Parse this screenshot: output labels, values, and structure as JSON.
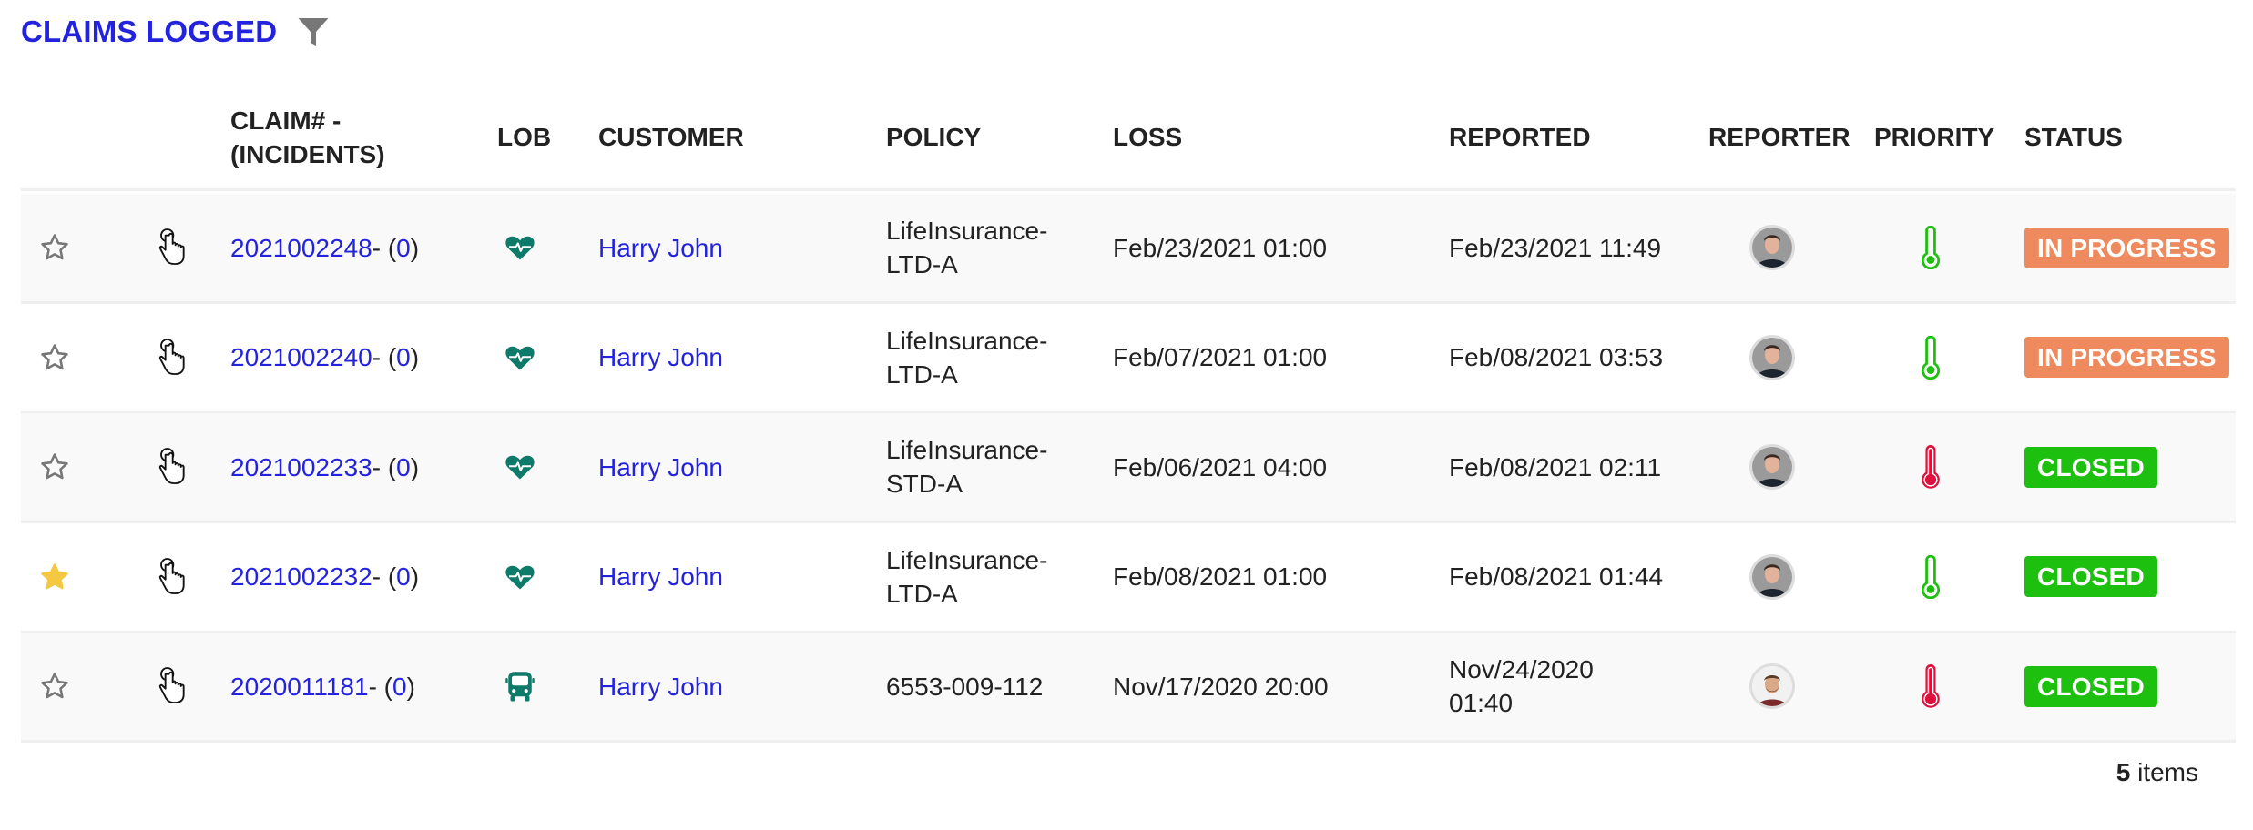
{
  "header": {
    "title": "CLAIMS LOGGED",
    "filter_icon": "filter-icon"
  },
  "colors": {
    "title": "#2323de",
    "link": "#2323de",
    "lob_icon": "#0d7a6a",
    "star_favorite": "#f5c842",
    "star_empty": "#777777",
    "priority_low": "#1ec010",
    "priority_high": "#e0103c",
    "status_in_progress": "#ee8a5e",
    "status_closed": "#1ec010"
  },
  "columns": {
    "claim": "CLAIM# -",
    "claim_line2": "(INCIDENTS)",
    "lob": "LOB",
    "customer": "CUSTOMER",
    "policy": "POLICY",
    "loss": "LOSS",
    "reported": "REPORTED",
    "reporter": "REPORTER",
    "priority": "PRIORITY",
    "status": "STATUS"
  },
  "rows": [
    {
      "favorite": false,
      "claim": "2021002248",
      "sep": " - (",
      "incidents": "0",
      "close": ")",
      "lob_icon": "heartbeat-icon",
      "customer": "Harry John",
      "policy": "LifeInsurance-",
      "policy_line2": "LTD-A",
      "loss": "Feb/23/2021 01:00",
      "reported": "Feb/23/2021 11:49",
      "reported_line2": "",
      "reporter_avatar": "avatar-1",
      "priority": "low",
      "status": "IN PROGRESS"
    },
    {
      "favorite": false,
      "claim": "2021002240",
      "sep": " - (",
      "incidents": "0",
      "close": ")",
      "lob_icon": "heartbeat-icon",
      "customer": "Harry John",
      "policy": "LifeInsurance-",
      "policy_line2": "LTD-A",
      "loss": "Feb/07/2021 01:00",
      "reported": "Feb/08/2021 03:53",
      "reported_line2": "",
      "reporter_avatar": "avatar-1",
      "priority": "low",
      "status": "IN PROGRESS"
    },
    {
      "favorite": false,
      "claim": "2021002233",
      "sep": " - (",
      "incidents": "0",
      "close": ")",
      "lob_icon": "heartbeat-icon",
      "customer": "Harry John",
      "policy": "LifeInsurance-",
      "policy_line2": "STD-A",
      "loss": "Feb/06/2021 04:00",
      "reported": "Feb/08/2021 02:11",
      "reported_line2": "",
      "reporter_avatar": "avatar-1",
      "priority": "high",
      "status": "CLOSED"
    },
    {
      "favorite": true,
      "claim": "2021002232",
      "sep": " - (",
      "incidents": "0",
      "close": ")",
      "lob_icon": "heartbeat-icon",
      "customer": "Harry John",
      "policy": "LifeInsurance-",
      "policy_line2": "LTD-A",
      "loss": "Feb/08/2021 01:00",
      "reported": "Feb/08/2021 01:44",
      "reported_line2": "",
      "reporter_avatar": "avatar-1",
      "priority": "low",
      "status": "CLOSED"
    },
    {
      "favorite": false,
      "claim": "2020011181",
      "sep": " - (",
      "incidents": "0",
      "close": ")",
      "lob_icon": "bus-icon",
      "customer": "Harry John",
      "policy": "6553-009-112",
      "policy_line2": "",
      "loss": "Nov/17/2020 20:00",
      "reported": "Nov/24/2020",
      "reported_line2": "01:40",
      "reporter_avatar": "avatar-2",
      "priority": "high",
      "status": "CLOSED"
    }
  ],
  "footer": {
    "count": "5",
    "label": " items"
  }
}
